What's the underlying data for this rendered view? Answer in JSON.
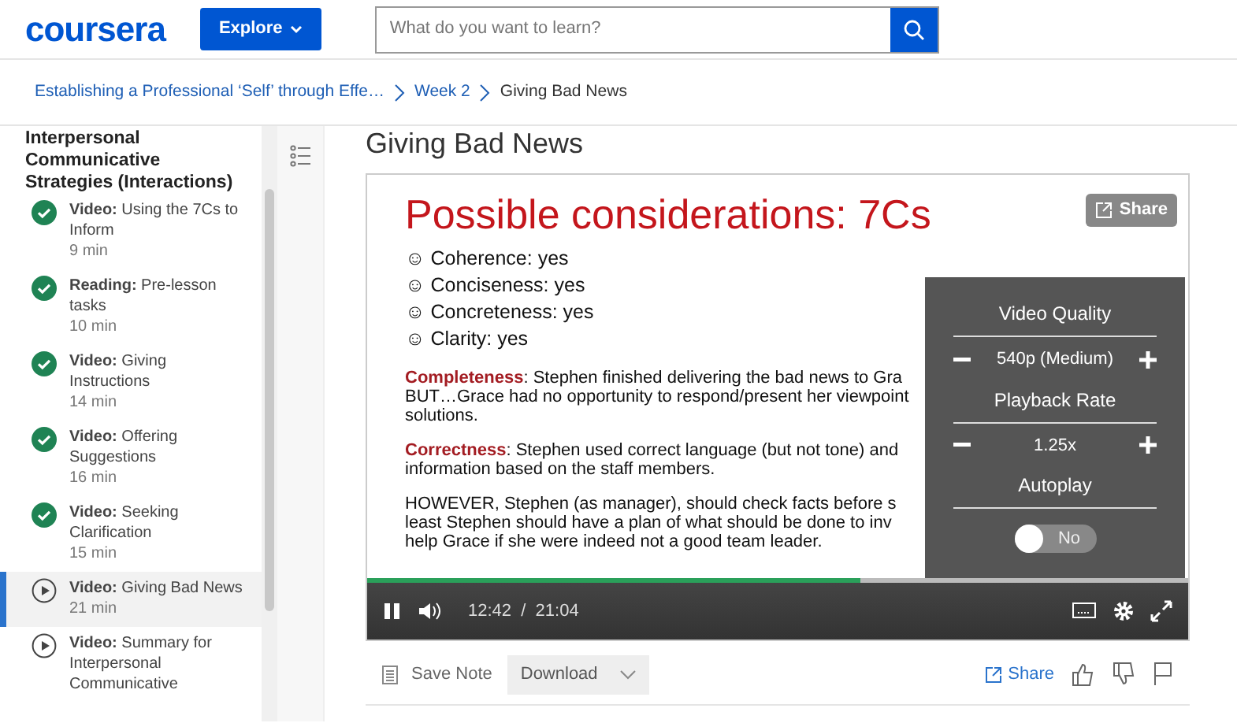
{
  "header": {
    "logo": "coursera",
    "explore": "Explore",
    "search": {
      "placeholder": "What do you want to learn?"
    }
  },
  "breadcrumb": [
    {
      "label": "Establishing a Professional ‘Self’ through Effe…",
      "current": false
    },
    {
      "label": "Week 2",
      "current": false
    },
    {
      "label": "Giving Bad News",
      "current": true
    }
  ],
  "sidebar": {
    "section_title": "Interpersonal Communicative Strategies (Interactions)",
    "items": [
      {
        "type": "Video:",
        "title": "Using the 7Cs to Inform",
        "duration": "9 min",
        "completed": true,
        "selected": false
      },
      {
        "type": "Reading:",
        "title": "Pre-lesson tasks",
        "duration": "10 min",
        "completed": true,
        "selected": false
      },
      {
        "type": "Video:",
        "title": "Giving Instructions",
        "duration": "14 min",
        "completed": true,
        "selected": false
      },
      {
        "type": "Video:",
        "title": "Offering Suggestions",
        "duration": "16 min",
        "completed": true,
        "selected": false
      },
      {
        "type": "Video:",
        "title": "Seeking Clarification",
        "duration": "15 min",
        "completed": true,
        "selected": false
      },
      {
        "type": "Video:",
        "title": "Giving Bad News",
        "duration": "21 min",
        "completed": false,
        "selected": true
      },
      {
        "type": "Video:",
        "title": "Summary for Interpersonal Communicative",
        "completed": false,
        "selected": false
      }
    ]
  },
  "page_title": "Giving Bad News",
  "video": {
    "slide": {
      "heading": "Possible considerations: 7Cs",
      "bullets": [
        "☺ Coherence: yes",
        "☺ Conciseness: yes",
        "☺ Concreteness: yes",
        "☺ Clarity: yes"
      ],
      "paragraphs": [
        [
          "**Completeness**: Stephen finished delivering the bad news to Gra",
          "BUT…Grace had no opportunity to respond/present her viewpoint",
          "solutions."
        ],
        [
          "**Correctness**: Stephen used correct language (but not tone) and",
          "information based on the staff members."
        ],
        [
          "HOWEVER, Stephen (as manager), should check facts before s",
          "least Stephen should have a plan of what should be done to inv",
          "help Grace if she were indeed not a good team leader."
        ]
      ]
    },
    "share": "Share",
    "settings": {
      "quality_label": "Video Quality",
      "quality": "540p (Medium)",
      "rate_label": "Playback Rate",
      "rate": "1.25x",
      "autoplay_label": "Autoplay",
      "autoplay": false,
      "autoplay_text": "No"
    },
    "progress": {
      "level": 0.6
    },
    "time": "12:42  /  21:04"
  },
  "actions": {
    "save_note": "Save Note",
    "download": "Download",
    "share": "Share"
  }
}
